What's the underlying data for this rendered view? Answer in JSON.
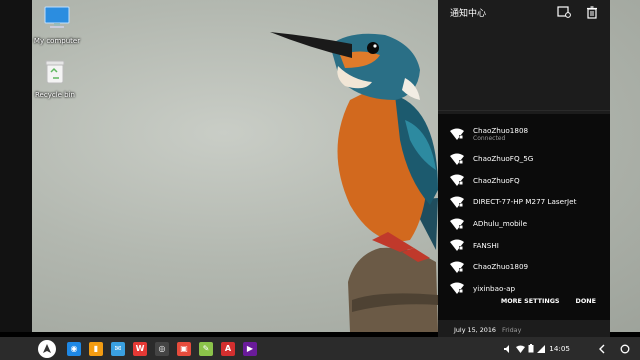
{
  "desktop": {
    "icons": [
      {
        "label": "My computer",
        "icon": "monitor-icon"
      },
      {
        "label": "Recycle bin",
        "icon": "recycle-bin-icon"
      }
    ]
  },
  "panel": {
    "title": "通知中心",
    "header_icons": [
      "notification-settings-icon",
      "trash-icon"
    ],
    "wifi": {
      "networks": [
        {
          "ssid": "ChaoZhuo1808",
          "status": "Connected",
          "secured": true
        },
        {
          "ssid": "ChaoZhuoFQ_5G",
          "status": "",
          "secured": true
        },
        {
          "ssid": "ChaoZhuoFQ",
          "status": "",
          "secured": true
        },
        {
          "ssid": "DIRECT-77-HP M277 LaserJet",
          "status": "",
          "secured": true
        },
        {
          "ssid": "ADhulu_mobile",
          "status": "",
          "secured": true
        },
        {
          "ssid": "FANSHI",
          "status": "",
          "secured": true
        },
        {
          "ssid": "ChaoZhuo1809",
          "status": "",
          "secured": true
        },
        {
          "ssid": "yixinbao-ap",
          "status": "",
          "secured": true
        }
      ],
      "more_settings": "MORE SETTINGS",
      "done": "DONE"
    },
    "footer": {
      "date": "July 15, 2016",
      "weekday": "Friday"
    }
  },
  "taskbar": {
    "apps": [
      {
        "name": "browser-app",
        "color": "#1e88e5",
        "glyph": "◉"
      },
      {
        "name": "files-app",
        "color": "#f39c12",
        "glyph": "▮"
      },
      {
        "name": "mail-app",
        "color": "#3aa0e0",
        "glyph": "✉"
      },
      {
        "name": "wps-app",
        "color": "#e53935",
        "glyph": "W"
      },
      {
        "name": "camera-app",
        "color": "#444444",
        "glyph": "◎"
      },
      {
        "name": "red-app",
        "color": "#e74c3c",
        "glyph": "▣"
      },
      {
        "name": "photo-app",
        "color": "#8bc34a",
        "glyph": "✎"
      },
      {
        "name": "pdf-app",
        "color": "#d32f2f",
        "glyph": "A"
      },
      {
        "name": "video-app",
        "color": "#6a1b9a",
        "glyph": "▶"
      }
    ],
    "clock": "14:05"
  },
  "colors": {
    "panel_bg": "#1c1c1c",
    "wifi_sheet_bg": "#0b0b0b",
    "taskbar_bg": "#2b2b2b"
  }
}
